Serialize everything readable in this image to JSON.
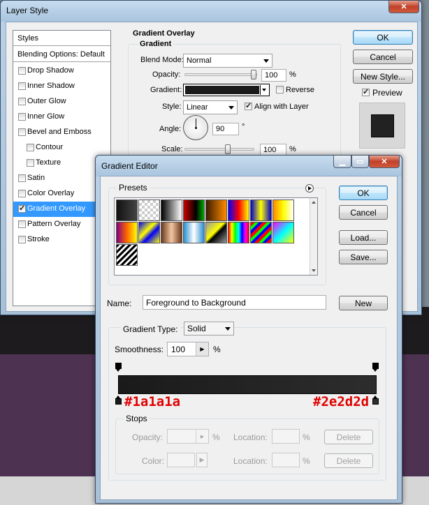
{
  "layer_style": {
    "title": "Layer Style",
    "styles_header": "Styles",
    "blending_options": "Blending Options: Default",
    "items": [
      {
        "label": "Drop Shadow",
        "checked": false,
        "indent": false
      },
      {
        "label": "Inner Shadow",
        "checked": false,
        "indent": false
      },
      {
        "label": "Outer Glow",
        "checked": false,
        "indent": false
      },
      {
        "label": "Inner Glow",
        "checked": false,
        "indent": false
      },
      {
        "label": "Bevel and Emboss",
        "checked": false,
        "indent": false
      },
      {
        "label": "Contour",
        "checked": false,
        "indent": true
      },
      {
        "label": "Texture",
        "checked": false,
        "indent": true
      },
      {
        "label": "Satin",
        "checked": false,
        "indent": false
      },
      {
        "label": "Color Overlay",
        "checked": false,
        "indent": false
      },
      {
        "label": "Gradient Overlay",
        "checked": true,
        "indent": false,
        "selected": true
      },
      {
        "label": "Pattern Overlay",
        "checked": false,
        "indent": false
      },
      {
        "label": "Stroke",
        "checked": false,
        "indent": false
      }
    ],
    "section_title": "Gradient Overlay",
    "group_title": "Gradient",
    "blend_mode_label": "Blend Mode:",
    "blend_mode_value": "Normal",
    "opacity_label": "Opacity:",
    "opacity_value": "100",
    "percent": "%",
    "gradient_label": "Gradient:",
    "reverse_label": "Reverse",
    "style_label": "Style:",
    "style_value": "Linear",
    "align_label": "Align with Layer",
    "angle_label": "Angle:",
    "angle_value": "90",
    "degree": "°",
    "scale_label": "Scale:",
    "scale_value": "100",
    "ok": "OK",
    "cancel": "Cancel",
    "new_style": "New Style...",
    "preview_label": "Preview",
    "preview_checked": true
  },
  "gradient_editor": {
    "title": "Gradient Editor",
    "presets_label": "Presets",
    "ok": "OK",
    "cancel": "Cancel",
    "load": "Load...",
    "save": "Save...",
    "name_label": "Name:",
    "name_value": "Foreground to Background",
    "new_button": "New",
    "gradient_type_label": "Gradient Type:",
    "gradient_type_value": "Solid",
    "smoothness_label": "Smoothness:",
    "smoothness_value": "100",
    "percent": "%",
    "stops_label": "Stops",
    "opacity_label": "Opacity:",
    "location_label": "Location:",
    "color_label": "Color:",
    "delete": "Delete",
    "start_color": "#1a1a1a",
    "end_color": "#2e2d2d",
    "start_annotation": "#1a1a1a",
    "end_annotation": "#2e2d2d"
  }
}
